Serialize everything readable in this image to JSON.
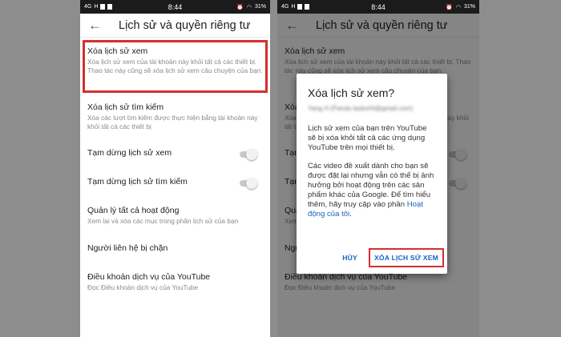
{
  "status": {
    "network": "4G",
    "signal": "H",
    "time": "8:44",
    "battery": "31%"
  },
  "appbar": {
    "title": "Lịch sử và quyền riêng tư"
  },
  "settings": [
    {
      "title": "Xóa lịch sử xem",
      "subtitle": "Xóa lịch sử xem của tài khoản này khỏi tất cả các thiết bị. Thao tác này cũng sẽ xóa lịch sử xem câu chuyện của bạn."
    },
    {
      "title": "Xóa lịch sử tìm kiếm",
      "subtitle": "Xóa các lượt tìm kiếm được thực hiện bằng tài khoản này khỏi tất cả các thiết bị"
    },
    {
      "title": "Tạm dừng lịch sử xem",
      "toggle": false
    },
    {
      "title": "Tạm dừng lịch sử tìm kiếm",
      "toggle": false
    },
    {
      "title": "Quản lý tất cả hoạt động",
      "subtitle": "Xem lại và xóa các mục trong phần lịch sử của bạn"
    },
    {
      "title": "Người liên hệ bị chặn"
    },
    {
      "title": "Điều khoản dịch vụ của YouTube",
      "subtitle": "Đọc Điều khoản dịch vụ của YouTube"
    }
  ],
  "dialog": {
    "title": "Xóa lịch sử xem?",
    "account": "Yang H (Panda lasbxrhl@gmail.com)",
    "p1": "Lịch sử xem của bạn trên YouTube sẽ bị xóa khỏi tất cả các ứng dụng YouTube trên mọi thiết bị.",
    "p2": "Các video đề xuất dành cho bạn sẽ được đặt lại nhưng vẫn có thể bị ảnh hưởng bởi hoạt động trên các sản phẩm khác của Google. Để tìm hiểu thêm, hãy truy cập vào phần",
    "link": "Hoạt động của tôi",
    "p2_end": ".",
    "cancel": "HỦY",
    "confirm": "XÓA LỊCH SỬ XEM"
  },
  "colors": {
    "accent": "#1565c0",
    "highlight": "#d32f2f",
    "statusbar": "#1b1b1b"
  }
}
